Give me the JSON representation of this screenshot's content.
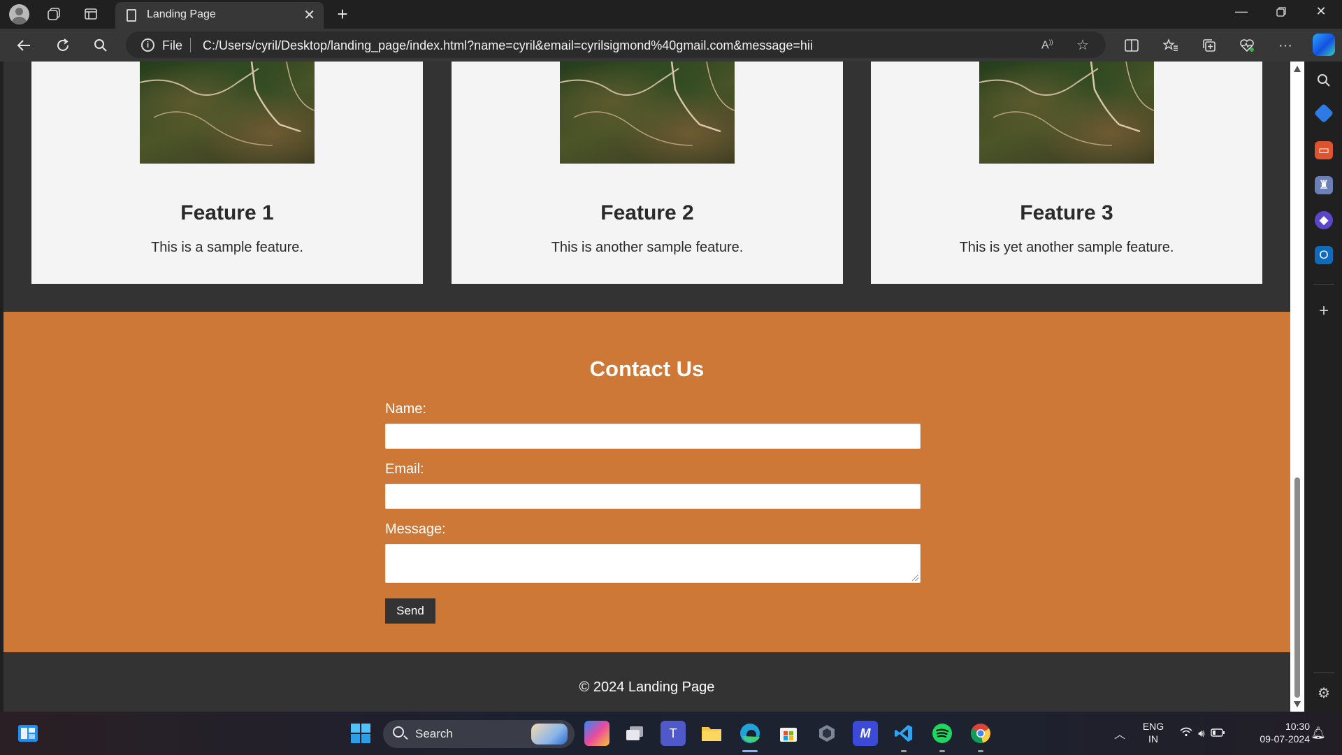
{
  "browser": {
    "tab_title": "Landing Page",
    "url_scheme_label": "File",
    "url": "C:/Users/cyril/Desktop/landing_page/index.html?name=cyril&email=cyrilsigmond%40gmail.com&message=hii"
  },
  "page": {
    "features": [
      {
        "title": "Feature 1",
        "description": "This is a sample feature."
      },
      {
        "title": "Feature 2",
        "description": "This is another sample feature."
      },
      {
        "title": "Feature 3",
        "description": "This is yet another sample feature."
      }
    ],
    "contact": {
      "heading": "Contact Us",
      "name_label": "Name:",
      "email_label": "Email:",
      "message_label": "Message:",
      "send_label": "Send"
    },
    "footer": "© 2024 Landing Page"
  },
  "taskbar": {
    "search_placeholder": "Search",
    "lang_primary": "ENG",
    "lang_secondary": "IN",
    "time": "10:30",
    "date": "09-07-2024"
  },
  "colors": {
    "contact_bg": "#cd7837",
    "page_bg": "#333333",
    "card_bg": "#f4f4f4",
    "button_bg": "#333333"
  }
}
